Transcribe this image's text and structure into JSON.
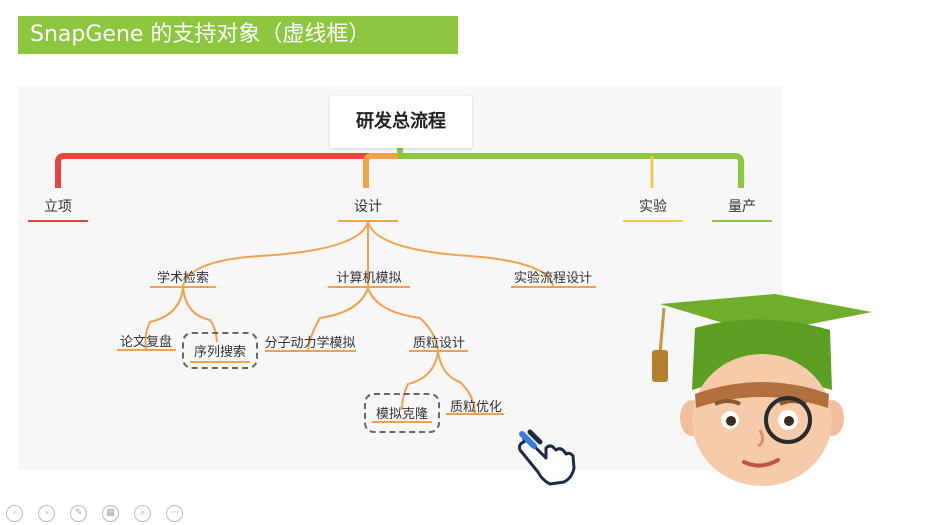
{
  "slide": {
    "title": "SnapGene 的支持对象（虚线框）"
  },
  "mindmap": {
    "root": "研发总流程",
    "level1": {
      "lixiang": "立项",
      "sheji": "设计",
      "shiyan": "实验",
      "liangchan": "量产"
    },
    "level2": {
      "xueshu": "学术检索",
      "jisuanji": "计算机模拟",
      "shiyanliucheng": "实验流程设计"
    },
    "level3": {
      "lunwen": "论文复盘",
      "xulie": "序列搜索",
      "fenzi": "分子动力学模拟",
      "zhili": "质粒设计"
    },
    "level4": {
      "moni": "模拟克隆",
      "youhua": "质粒优化"
    }
  },
  "colors": {
    "title_bg": "#8dc63f",
    "red": "#e8453c",
    "orange": "#f5a04a",
    "green": "#8dc63f",
    "yellow": "#f2c94c",
    "sage": "#8bbf4a"
  },
  "icons": {
    "hand": "pointing-hand-icon",
    "avatar": "graduate-avatar"
  }
}
